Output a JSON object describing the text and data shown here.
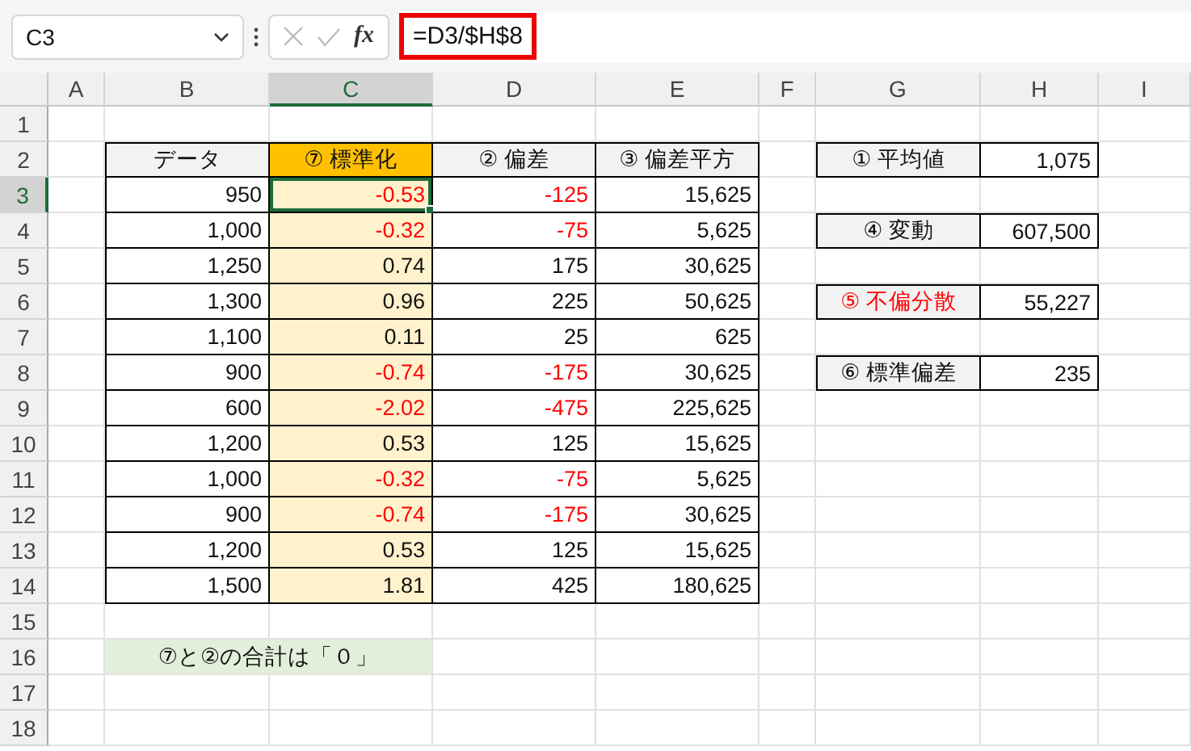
{
  "name_box": {
    "value": "C3"
  },
  "formula_bar": {
    "function_label": "fx",
    "formula": "=D3/$H$8",
    "highlighted": true
  },
  "column_headers": [
    {
      "label": "A",
      "selected": false
    },
    {
      "label": "B",
      "selected": false
    },
    {
      "label": "C",
      "selected": true
    },
    {
      "label": "D",
      "selected": false
    },
    {
      "label": "E",
      "selected": false
    },
    {
      "label": "F",
      "selected": false
    },
    {
      "label": "G",
      "selected": false
    },
    {
      "label": "H",
      "selected": false
    },
    {
      "label": "I",
      "selected": false
    }
  ],
  "row_headers": [
    {
      "label": "1",
      "selected": false
    },
    {
      "label": "2",
      "selected": false
    },
    {
      "label": "3",
      "selected": true
    },
    {
      "label": "4",
      "selected": false
    },
    {
      "label": "5",
      "selected": false
    },
    {
      "label": "6",
      "selected": false
    },
    {
      "label": "7",
      "selected": false
    },
    {
      "label": "8",
      "selected": false
    },
    {
      "label": "9",
      "selected": false
    },
    {
      "label": "10",
      "selected": false
    },
    {
      "label": "11",
      "selected": false
    },
    {
      "label": "12",
      "selected": false
    },
    {
      "label": "13",
      "selected": false
    },
    {
      "label": "14",
      "selected": false
    },
    {
      "label": "15",
      "selected": false
    },
    {
      "label": "16",
      "selected": false
    },
    {
      "label": "17",
      "selected": false
    },
    {
      "label": "18",
      "selected": false
    }
  ],
  "main_table": {
    "headers": [
      {
        "label": "データ",
        "kind": "plain"
      },
      {
        "label": "⑦ 標準化",
        "kind": "accent"
      },
      {
        "label": "② 偏差",
        "kind": "plain"
      },
      {
        "label": "③ 偏差平方",
        "kind": "plain"
      }
    ],
    "rows": [
      {
        "data": "950",
        "standardized": "-0.53",
        "deviation": "-125",
        "squared": "15,625",
        "negative": true,
        "selected": true
      },
      {
        "data": "1,000",
        "standardized": "-0.32",
        "deviation": "-75",
        "squared": "5,625",
        "negative": true,
        "selected": false
      },
      {
        "data": "1,250",
        "standardized": "0.74",
        "deviation": "175",
        "squared": "30,625",
        "negative": false,
        "selected": false
      },
      {
        "data": "1,300",
        "standardized": "0.96",
        "deviation": "225",
        "squared": "50,625",
        "negative": false,
        "selected": false
      },
      {
        "data": "1,100",
        "standardized": "0.11",
        "deviation": "25",
        "squared": "625",
        "negative": false,
        "selected": false
      },
      {
        "data": "900",
        "standardized": "-0.74",
        "deviation": "-175",
        "squared": "30,625",
        "negative": true,
        "selected": false
      },
      {
        "data": "600",
        "standardized": "-2.02",
        "deviation": "-475",
        "squared": "225,625",
        "negative": true,
        "selected": false
      },
      {
        "data": "1,200",
        "standardized": "0.53",
        "deviation": "125",
        "squared": "15,625",
        "negative": false,
        "selected": false
      },
      {
        "data": "1,000",
        "standardized": "-0.32",
        "deviation": "-75",
        "squared": "5,625",
        "negative": true,
        "selected": false
      },
      {
        "data": "900",
        "standardized": "-0.74",
        "deviation": "-175",
        "squared": "30,625",
        "negative": true,
        "selected": false
      },
      {
        "data": "1,200",
        "standardized": "0.53",
        "deviation": "125",
        "squared": "15,625",
        "negative": false,
        "selected": false
      },
      {
        "data": "1,500",
        "standardized": "1.81",
        "deviation": "425",
        "squared": "180,625",
        "negative": false,
        "selected": false
      }
    ]
  },
  "summary": [
    {
      "label": "① 平均値",
      "value": "1,075",
      "emphasized": false
    },
    {
      "label": "④ 変動",
      "value": "607,500",
      "emphasized": false
    },
    {
      "label": "⑤ 不偏分散",
      "value": "55,227",
      "emphasized": true
    },
    {
      "label": "⑥ 標準偏差",
      "value": "235",
      "emphasized": false
    }
  ],
  "note": "⑦と②の合計は「０」"
}
